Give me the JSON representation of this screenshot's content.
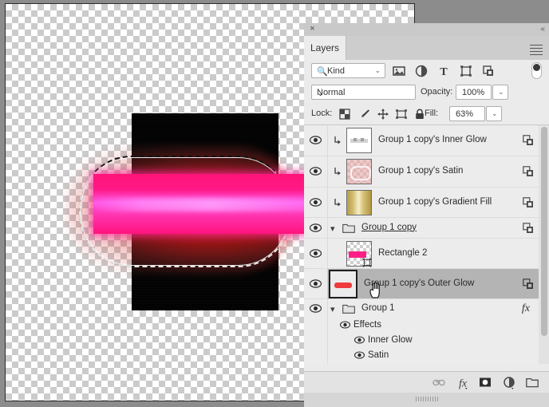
{
  "panel": {
    "close_icon": "×",
    "collapse_icon": "«",
    "menu_icon": "panel-menu",
    "tab_label": "Layers"
  },
  "filter": {
    "kind_label": "Kind",
    "search_icon": "search-icon",
    "caret": "⌄",
    "icons": [
      "pixel-layer-filter-icon",
      "adjustment-layer-filter-icon",
      "type-layer-filter-icon",
      "shape-layer-filter-icon",
      "smart-object-filter-icon"
    ],
    "toggle_icon": "filter-toggle-switch"
  },
  "blend": {
    "mode": "Normal",
    "caret": "⌄",
    "opacity_label": "Opacity:",
    "opacity_value": "100%"
  },
  "lock": {
    "label": "Lock:",
    "icons": [
      "lock-transparent-pixels-icon",
      "lock-image-pixels-icon",
      "lock-position-icon",
      "lock-artboard-nesting-icon",
      "lock-all-icon"
    ],
    "fill_label": "Fill:",
    "fill_value": "63%"
  },
  "layers": [
    {
      "name": "Group 1 copy's Inner Glow",
      "thumb": "white-inner-glow",
      "kind": "effect-layer",
      "visible": true,
      "selected": false,
      "linked_badge": true,
      "underline": false
    },
    {
      "name": "Group 1 copy's Satin",
      "thumb": "pink-satin",
      "kind": "effect-layer",
      "visible": true,
      "selected": false,
      "linked_badge": true,
      "underline": false
    },
    {
      "name": "Group 1 copy's Gradient Fill",
      "thumb": "gold-gradient",
      "kind": "effect-layer",
      "visible": true,
      "selected": false,
      "linked_badge": true,
      "underline": false
    },
    {
      "name": "Group 1 copy",
      "thumb": "folder",
      "kind": "group",
      "visible": true,
      "selected": false,
      "linked_badge": true,
      "underline": true
    },
    {
      "name": "Rectangle 2",
      "thumb": "pink-rect",
      "kind": "shape",
      "visible": true,
      "selected": false,
      "linked_badge": false,
      "underline": false
    },
    {
      "name": "Group 1 copy's Outer Glow",
      "thumb": "red-bar",
      "kind": "effect-layer",
      "visible": true,
      "selected": true,
      "linked_badge": true,
      "underline": false
    },
    {
      "name": "Group 1",
      "thumb": "folder",
      "kind": "group",
      "visible": true,
      "selected": false,
      "linked_badge": false,
      "underline": false,
      "fx_mark": "fx",
      "fx_caret": "^"
    }
  ],
  "effects": [
    {
      "name": "Effects",
      "indent": 0,
      "visible": true
    },
    {
      "name": "Inner Glow",
      "indent": 1,
      "visible": true
    },
    {
      "name": "Satin",
      "indent": 1,
      "visible": true
    }
  ],
  "footer_icons": [
    "link-layers-icon",
    "add-layer-style-icon",
    "add-layer-mask-icon",
    "new-adjustment-layer-icon",
    "new-group-icon",
    "new-layer-icon",
    "delete-layer-icon"
  ],
  "footer_fx_label": "fx",
  "canvas": {
    "title": "document-canvas",
    "selection": "marching-ants-selection",
    "cursor": "hand-cursor"
  },
  "colors": {
    "panel_bg": "#ebebeb",
    "selected_row": "#b4b4b4",
    "pink": "#ff1e86",
    "magenta_core": "#ff5aeb",
    "glow_red": "#ff2828",
    "gold": "#c9b15c",
    "app_bg": "#8c8c8c"
  }
}
